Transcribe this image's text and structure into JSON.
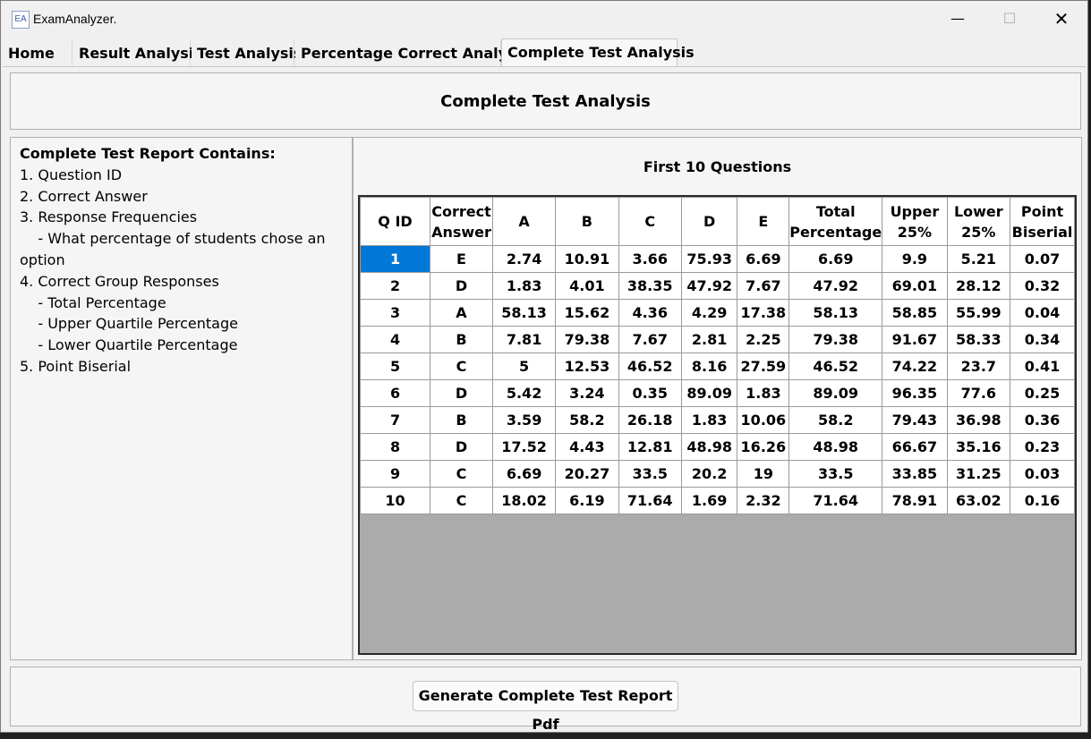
{
  "window": {
    "icon_text": "EA",
    "title": "ExamAnalyzer.",
    "controls": {
      "minimize": "—",
      "maximize": "☐",
      "close": "✕"
    }
  },
  "tabs": [
    {
      "label": "Home"
    },
    {
      "label": "Result Analysis"
    },
    {
      "label": "Test Analysis"
    },
    {
      "label": "Percentage Correct Analysis"
    },
    {
      "label": "Complete Test Analysis"
    }
  ],
  "header": {
    "title": "Complete Test Analysis"
  },
  "info": {
    "heading": "Complete Test Report Contains:",
    "lines": [
      "1. Question ID",
      "2. Correct Answer",
      "3. Response Frequencies",
      "    - What percentage of students chose an",
      "option",
      "4. Correct Group Responses",
      "    - Total Percentage",
      "    - Upper Quartile Percentage",
      "    - Lower Quartile Percentage",
      "5. Point Biserial"
    ]
  },
  "table": {
    "title": "First 10 Questions",
    "columns": [
      [
        "Q ID"
      ],
      [
        "Correct",
        "Answer"
      ],
      [
        "A"
      ],
      [
        "B"
      ],
      [
        "C"
      ],
      [
        "D"
      ],
      [
        "E"
      ],
      [
        "Total",
        "Percentage"
      ],
      [
        "Upper",
        "25%"
      ],
      [
        "Lower",
        "25%"
      ],
      [
        "Point",
        "Biserial"
      ]
    ],
    "rows": [
      [
        "1",
        "E",
        "2.74",
        "10.91",
        "3.66",
        "75.93",
        "6.69",
        "6.69",
        "9.9",
        "5.21",
        "0.07"
      ],
      [
        "2",
        "D",
        "1.83",
        "4.01",
        "38.35",
        "47.92",
        "7.67",
        "47.92",
        "69.01",
        "28.12",
        "0.32"
      ],
      [
        "3",
        "A",
        "58.13",
        "15.62",
        "4.36",
        "4.29",
        "17.38",
        "58.13",
        "58.85",
        "55.99",
        "0.04"
      ],
      [
        "4",
        "B",
        "7.81",
        "79.38",
        "7.67",
        "2.81",
        "2.25",
        "79.38",
        "91.67",
        "58.33",
        "0.34"
      ],
      [
        "5",
        "C",
        "5",
        "12.53",
        "46.52",
        "8.16",
        "27.59",
        "46.52",
        "74.22",
        "23.7",
        "0.41"
      ],
      [
        "6",
        "D",
        "5.42",
        "3.24",
        "0.35",
        "89.09",
        "1.83",
        "89.09",
        "96.35",
        "77.6",
        "0.25"
      ],
      [
        "7",
        "B",
        "3.59",
        "58.2",
        "26.18",
        "1.83",
        "10.06",
        "58.2",
        "79.43",
        "36.98",
        "0.36"
      ],
      [
        "8",
        "D",
        "17.52",
        "4.43",
        "12.81",
        "48.98",
        "16.26",
        "48.98",
        "66.67",
        "35.16",
        "0.23"
      ],
      [
        "9",
        "C",
        "6.69",
        "20.27",
        "33.5",
        "20.2",
        "19",
        "33.5",
        "33.85",
        "31.25",
        "0.03"
      ],
      [
        "10",
        "C",
        "18.02",
        "6.19",
        "71.64",
        "1.69",
        "2.32",
        "71.64",
        "78.91",
        "63.02",
        "0.16"
      ]
    ],
    "selected_row": 0
  },
  "footer": {
    "generate_button": "Generate Complete Test Report Pdf"
  }
}
